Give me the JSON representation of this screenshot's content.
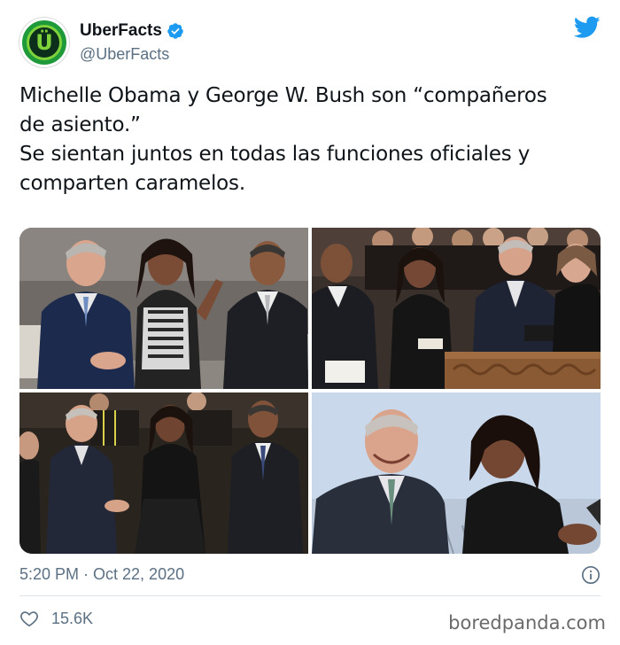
{
  "author": {
    "display_name": "UberFacts",
    "handle": "@UberFacts",
    "avatar_letter": "Ü",
    "avatar_colors": {
      "outer": "#1f9a3a",
      "inner": "#0b2f1a",
      "accent": "#7fd33a"
    },
    "verified": true
  },
  "brand": {
    "icon": "twitter-bird-icon",
    "color": "#1d9bf0"
  },
  "tweet": {
    "lines": [
      "Michelle Obama y George W. Bush son “compañeros",
      "de asiento.”",
      "Se sientan juntos en todas las funciones oficiales y",
      "comparten caramelos."
    ]
  },
  "media": [
    {
      "name": "photo-top-left"
    },
    {
      "name": "photo-top-right"
    },
    {
      "name": "photo-bottom-left"
    },
    {
      "name": "photo-bottom-right"
    }
  ],
  "meta": {
    "timestamp": "5:20 PM · Oct 22, 2020",
    "info_icon": "info-icon"
  },
  "engagement": {
    "likes": "15.6K",
    "like_icon": "heart-icon"
  },
  "watermark": "boredpanda.com"
}
